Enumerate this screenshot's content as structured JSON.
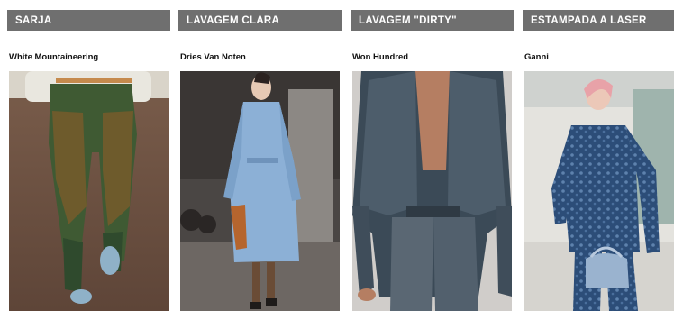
{
  "cards": [
    {
      "category": "SARJA",
      "brand": "White Mountaineering",
      "image": "model in olive green twill trousers"
    },
    {
      "category": "LAVAGEM CLARA",
      "brand": "Dries Van Noten",
      "image": "model in light wash denim trench coat"
    },
    {
      "category": "LAVAGEM \"DIRTY\"",
      "brand": "Won Hundred",
      "image": "model in dirty wash denim jacket and jeans"
    },
    {
      "category": "ESTAMPADA A LASER",
      "brand": "Ganni",
      "image": "model in laser printed denim jacket and pants"
    }
  ],
  "colors": {
    "header_bg": "#6f6f6f",
    "header_text": "#ffffff"
  }
}
